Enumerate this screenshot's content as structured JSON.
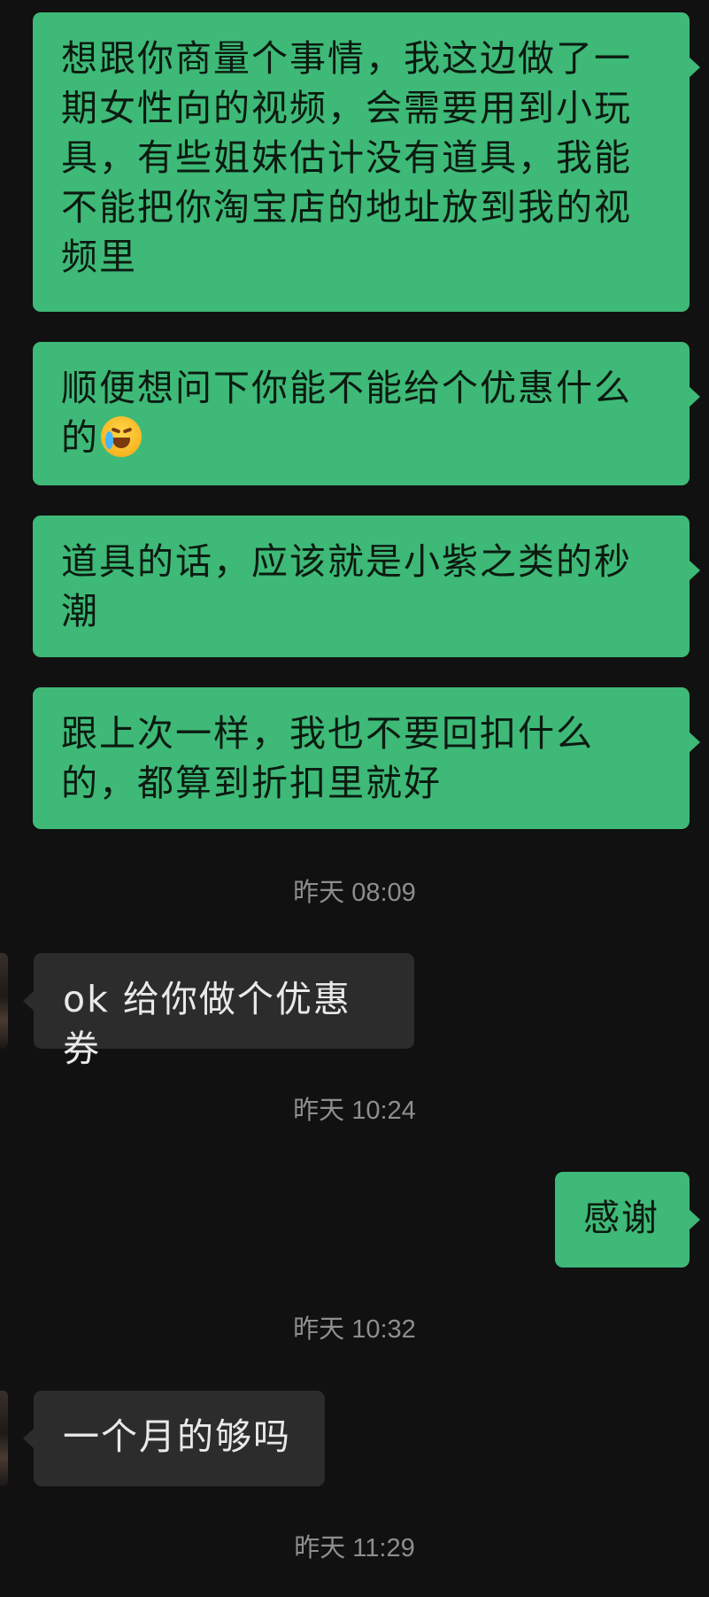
{
  "messages": [
    {
      "direction": "outgoing",
      "text": "想跟你商量个事情，我这边做了一期女性向的视频，会需要用到小玩具，有些姐妹估计没有道具，我能不能把你淘宝店的地址放到我的视频里"
    },
    {
      "direction": "outgoing",
      "text": "顺便想问下你能不能给个优惠什么的",
      "emoji": "face-with-tears-of-joy"
    },
    {
      "direction": "outgoing",
      "text": "道具的话，应该就是小紫之类的秒潮"
    },
    {
      "direction": "outgoing",
      "text": "跟上次一样，我也不要回扣什么的，都算到折扣里就好"
    },
    {
      "direction": "incoming",
      "text": "ok 给你做个优惠券"
    },
    {
      "direction": "outgoing",
      "text": "感谢"
    },
    {
      "direction": "incoming",
      "text": "一个月的够吗"
    }
  ],
  "timestamps": [
    "昨天 08:09",
    "昨天 10:24",
    "昨天 10:32",
    "昨天 11:29"
  ],
  "colors": {
    "background": "#111111",
    "outgoing_bubble": "#3eb977",
    "incoming_bubble": "#2c2c2c",
    "timestamp_text": "#8e8e8e"
  }
}
